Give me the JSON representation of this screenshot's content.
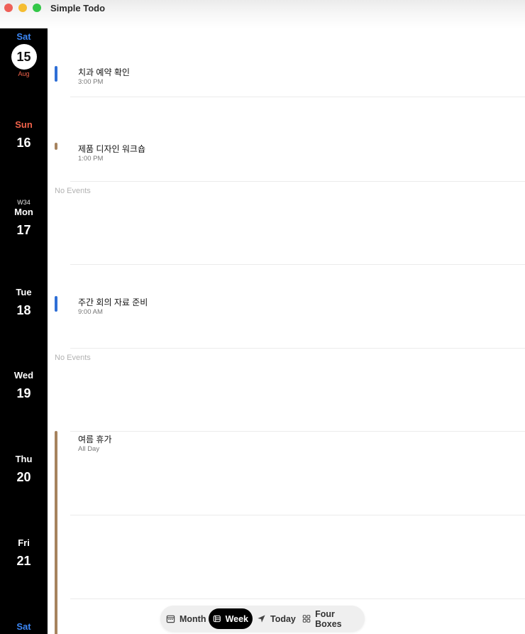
{
  "app": {
    "title": "Simple Todo"
  },
  "colors": {
    "blue": "#2f6fd6",
    "brown": "#a6835e",
    "today_red": "#f0624a"
  },
  "rail": {
    "days": [
      {
        "weekday": "Sat",
        "number": "15",
        "month": "Aug",
        "week": "",
        "today": true
      },
      {
        "weekday": "Sun",
        "number": "16",
        "week": ""
      },
      {
        "weekday": "Mon",
        "number": "17",
        "week": "W34"
      },
      {
        "weekday": "Tue",
        "number": "18",
        "week": ""
      },
      {
        "weekday": "Wed",
        "number": "19",
        "week": ""
      },
      {
        "weekday": "Thu",
        "number": "20",
        "week": ""
      },
      {
        "weekday": "Fri",
        "number": "21",
        "week": ""
      },
      {
        "weekday": "Sat",
        "number": "",
        "week": ""
      }
    ]
  },
  "events": {
    "sat": {
      "title": "치과 예약 확인",
      "time": "3:00 PM",
      "color": "blue"
    },
    "sun": {
      "title": "제품 디자인 워크숍",
      "time": "1:00 PM",
      "color": "brown"
    },
    "mon": {
      "empty": "No Events"
    },
    "tue": {
      "title": "주간 회의 자료 준비",
      "time": "9:00 AM",
      "color": "blue"
    },
    "wed": {
      "empty": "No Events"
    },
    "thu": {
      "title": "여름 휴가",
      "time": "All Day",
      "color": "brown"
    }
  },
  "tabs": {
    "month": "Month",
    "week": "Week",
    "today": "Today",
    "four_boxes": "Four Boxes",
    "selected": "Week"
  }
}
